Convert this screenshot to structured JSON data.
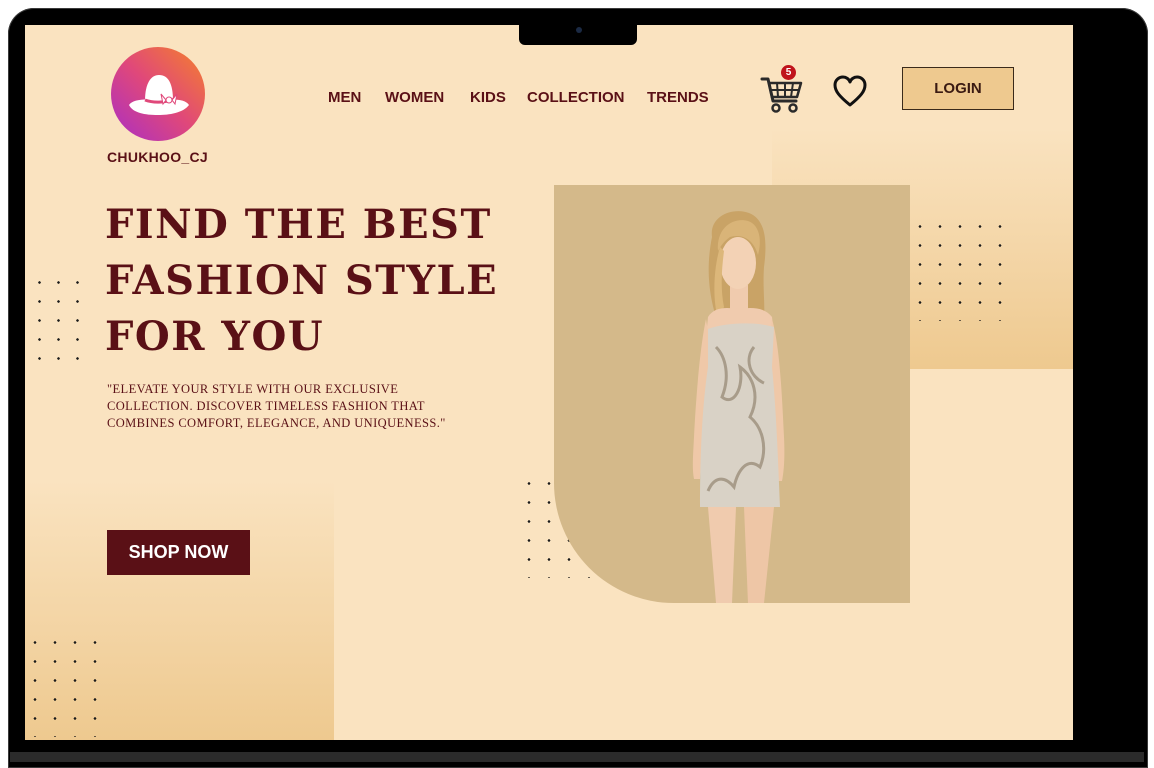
{
  "brand": {
    "name": "CHUKHOO_CJ",
    "logo_icon": "hat-icon"
  },
  "nav": {
    "items": [
      {
        "label": "MEN"
      },
      {
        "label": "WOMEN"
      },
      {
        "label": "KIDS"
      },
      {
        "label": "COLLECTION"
      },
      {
        "label": "TRENDS"
      }
    ]
  },
  "header": {
    "cart_icon": "cart-icon",
    "cart_count": "5",
    "wishlist_icon": "heart-icon",
    "login_label": "LOGIN"
  },
  "hero": {
    "headline_lines": [
      "FIND THE BEST",
      "FASHION STYLE",
      "FOR YOU"
    ],
    "subtext_lines": [
      "\"ELEVATE YOUR STYLE WITH OUR EXCLUSIVE",
      "COLLECTION. DISCOVER TIMELESS FASHION THAT",
      "COMBINES COMFORT, ELEGANCE, AND UNIQUENESS.\""
    ],
    "cta_label": "SHOP NOW"
  },
  "colors": {
    "background": "#fae3c0",
    "accent_dark": "#5a1016",
    "gold": "#eec98f",
    "photo_panel": "#d4b98a",
    "badge": "#c0141c"
  }
}
